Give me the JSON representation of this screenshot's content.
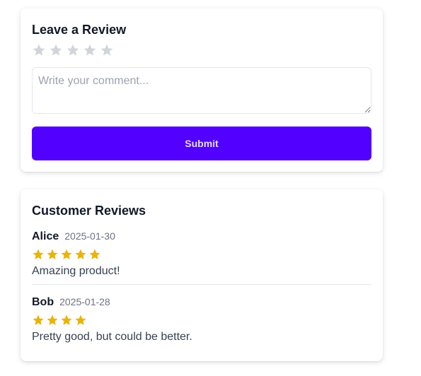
{
  "review_form": {
    "title": "Leave a Review",
    "rating": 0,
    "max_rating": 5,
    "star_color_empty": "#d1d5db",
    "comment_placeholder": "Write your comment...",
    "comment_value": "",
    "submit_label": "Submit",
    "submit_color": "#5200ff"
  },
  "reviews_section": {
    "title": "Customer Reviews",
    "star_color": "#eab308",
    "reviews": [
      {
        "name": "Alice",
        "date": "2025-01-30",
        "rating": 5,
        "text": "Amazing product!"
      },
      {
        "name": "Bob",
        "date": "2025-01-28",
        "rating": 4,
        "text": "Pretty good, but could be better."
      }
    ]
  }
}
